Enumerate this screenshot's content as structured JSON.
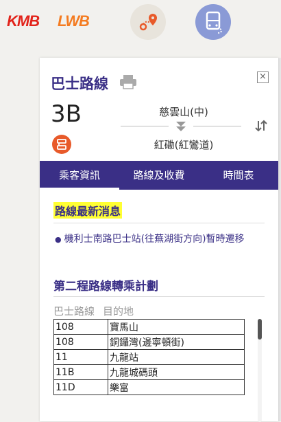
{
  "logos": {
    "kmb": "KMB",
    "lwb": "LWB"
  },
  "panel": {
    "title": "巴士路線",
    "route_number": "3B",
    "origin": "慈雲山(中)",
    "destination": "紅磡(紅鸞道)"
  },
  "tabs": [
    {
      "label": "乘客資訊",
      "active": true
    },
    {
      "label": "路線及收費",
      "active": false
    },
    {
      "label": "時間表",
      "active": false
    }
  ],
  "news": {
    "heading": "路線最新消息",
    "items": [
      "機利士南路巴士站(往蕪湖街方向)暫時遷移"
    ]
  },
  "interchange": {
    "heading": "第二程路線轉乘計劃",
    "col_route": "巴士路線",
    "col_destination": "目的地",
    "rows": [
      {
        "route": "108",
        "destination": "寶馬山"
      },
      {
        "route": "108",
        "destination": "銅鑼灣(邊寧頓街)"
      },
      {
        "route": "11",
        "destination": "九龍站"
      },
      {
        "route": "11B",
        "destination": "九龍城碼頭"
      },
      {
        "route": "11D",
        "destination": "樂富"
      }
    ]
  },
  "colors": {
    "accent": "#3a2f86",
    "highlight": "#ffff33",
    "kmb_red": "#e2231a",
    "lwb_orange": "#f47b20"
  }
}
